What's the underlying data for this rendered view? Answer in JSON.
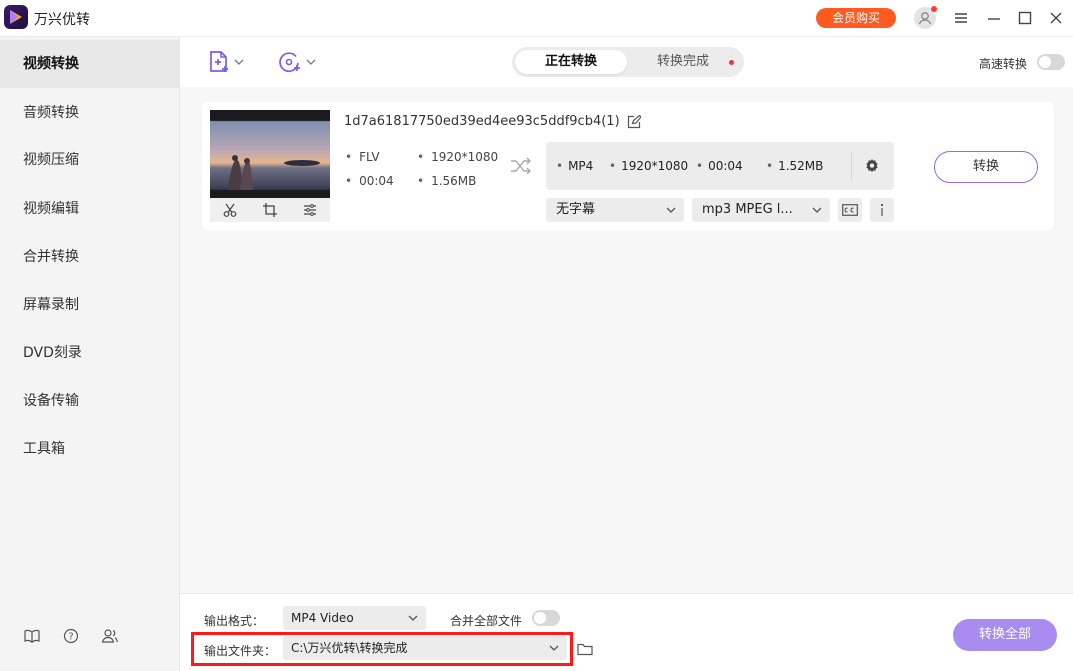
{
  "app": {
    "title": "万兴优转",
    "vip_label": "会员购买"
  },
  "colors": {
    "accent": "#8a6de8",
    "vip": "#ff5a1f",
    "highlight": "#ff1a1a",
    "convert_all_bg": "#a88cf0"
  },
  "sidebar": {
    "items": [
      {
        "label": "视频转换",
        "active": true
      },
      {
        "label": "音频转换"
      },
      {
        "label": "视频压缩"
      },
      {
        "label": "视频编辑"
      },
      {
        "label": "合并转换"
      },
      {
        "label": "屏幕录制"
      },
      {
        "label": "DVD刻录"
      },
      {
        "label": "设备传输"
      },
      {
        "label": "工具箱"
      }
    ],
    "footer_icons": [
      "book-icon",
      "help-icon",
      "users-icon"
    ]
  },
  "toolbar": {
    "tabs": [
      {
        "label": "正在转换",
        "active": true
      },
      {
        "label": "转换完成"
      }
    ],
    "high_speed_label": "高速转换"
  },
  "file": {
    "name": "1d7a61817750ed39ed4ee93c5ddf9cb4(1)",
    "source": {
      "format": "FLV",
      "resolution": "1920*1080",
      "duration": "00:04",
      "size": "1.56MB"
    },
    "target": {
      "format": "MP4",
      "resolution": "1920*1080",
      "duration": "00:04",
      "size": "1.52MB"
    },
    "subtitle": "无字幕",
    "audio": "mp3 MPEG l...",
    "convert_label": "转换"
  },
  "bottom": {
    "output_format_label": "输出格式：",
    "output_format_value": "MP4 Video",
    "merge_label": "合并全部文件",
    "output_folder_label": "输出文件夹：",
    "output_folder_value": "C:\\万兴优转\\转换完成",
    "convert_all_label": "转换全部"
  }
}
